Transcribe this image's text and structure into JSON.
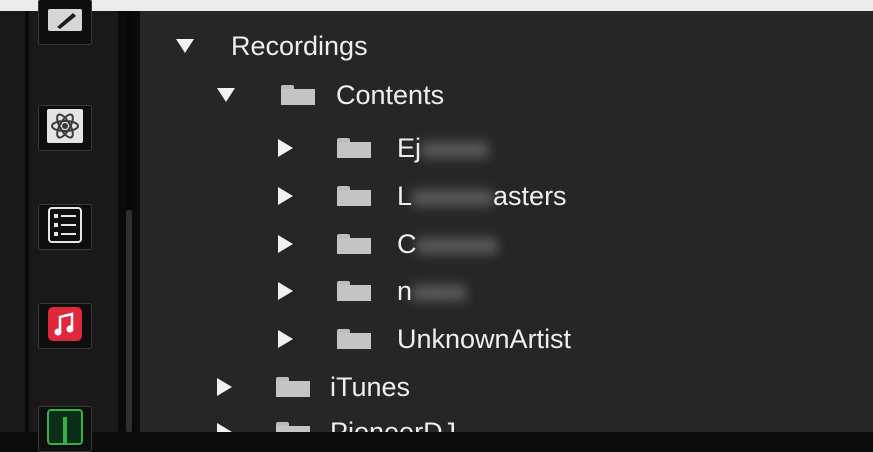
{
  "sidebar": {
    "buttons": [
      {
        "icon": "pen-edit-icon"
      },
      {
        "icon": "atom-icon"
      },
      {
        "icon": "list-view-icon"
      },
      {
        "icon": "music-app-icon",
        "accent": "#e0283c"
      },
      {
        "icon": "download-icon",
        "accent": "#36b04a"
      }
    ]
  },
  "tree": {
    "recordings": "Recordings",
    "contents": "Contents",
    "artist_1": "Ej",
    "artist_2_prefix": "L",
    "artist_2_suffix": "asters",
    "artist_3": "C",
    "artist_4": "n",
    "unknown_artist": "UnknownArtist",
    "itunes": "iTunes",
    "pioneer": "PioneerDJ"
  }
}
